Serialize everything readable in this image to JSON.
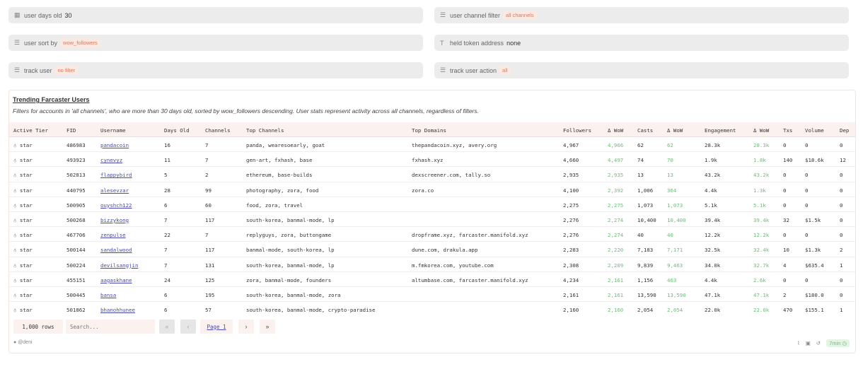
{
  "filters": [
    {
      "icon": "calendar-icon",
      "glyph": "▦",
      "label": "user days old",
      "value": "30",
      "type": "value"
    },
    {
      "icon": "list-icon",
      "glyph": "☰",
      "label": "user channel filter",
      "value": "all channels",
      "type": "tag"
    },
    {
      "icon": "list-icon",
      "glyph": "☰",
      "label": "user sort by",
      "value": "wow_followers",
      "type": "tag"
    },
    {
      "icon": "text-icon",
      "glyph": "T",
      "label": "held token address",
      "value": "none",
      "type": "value"
    },
    {
      "icon": "list-icon",
      "glyph": "☰",
      "label": "track user",
      "value": "no filter",
      "type": "tag"
    },
    {
      "icon": "list-icon",
      "glyph": "☰",
      "label": "track user action",
      "value": "all",
      "type": "tag"
    }
  ],
  "card": {
    "title": "Trending Farcaster Users",
    "description": "Filters for accounts in 'all channels', who are more than 30 days old, sorted by wow_followers descending. User stats represent activity across all channels, regardless of filters."
  },
  "table": {
    "columns": [
      "Active Tier",
      "FID",
      "Username",
      "Days Old",
      "Channels",
      "Top Channels",
      "Top Domains",
      "Followers",
      "Δ WoW",
      "Casts",
      "Δ WoW",
      "Engagement",
      "Δ WoW",
      "Txs",
      "Volume",
      "Dep"
    ],
    "rows": [
      [
        "star",
        "486983",
        "pandacoin",
        "16",
        "7",
        "panda, wearesoearly, goat",
        "thepandacoin.xyz, avery.org",
        "4,967",
        "4,966",
        "62",
        "62",
        "28.3k",
        "28.3k",
        "0",
        "0",
        "0"
      ],
      [
        "star",
        "493923",
        "cynevyz",
        "11",
        "7",
        "gen-art, fxhash, base",
        "fxhash.xyz",
        "4,660",
        "4,497",
        "74",
        "70",
        "1.9k",
        "1.8k",
        "140",
        "$18.6k",
        "12"
      ],
      [
        "star",
        "502813",
        "flappybird",
        "5",
        "2",
        "ethereum, base-builds",
        "dexscreener.com, tally.so",
        "2,935",
        "2,935",
        "13",
        "13",
        "43.2k",
        "43.2k",
        "0",
        "0",
        "0"
      ],
      [
        "star",
        "440795",
        "alesevzar",
        "28",
        "99",
        "photography, zora, food",
        "zora.co",
        "4,100",
        "2,392",
        "1,006",
        "364",
        "4.4k",
        "1.3k",
        "0",
        "0",
        "0"
      ],
      [
        "star",
        "500905",
        "ouyshch122",
        "6",
        "60",
        "food, zora, travel",
        "",
        "2,275",
        "2,275",
        "1,073",
        "1,073",
        "5.1k",
        "5.1k",
        "0",
        "0",
        "0"
      ],
      [
        "star",
        "500268",
        "bizzykong",
        "7",
        "117",
        "south-korea, banmal-mode, lp",
        "",
        "2,276",
        "2,274",
        "10,400",
        "10,400",
        "39.4k",
        "39.4k",
        "32",
        "$1.5k",
        "0"
      ],
      [
        "star",
        "467706",
        "zenpulse",
        "22",
        "7",
        "replyguys, zora, buttongame",
        "dropframe.xyz, farcaster.manifold.xyz",
        "2,276",
        "2,274",
        "40",
        "40",
        "12.2k",
        "12.2k",
        "0",
        "0",
        "0"
      ],
      [
        "star",
        "500144",
        "sandalwood",
        "7",
        "117",
        "banmal-mode, south-korea, lp",
        "dune.com, drakula.app",
        "2,283",
        "2,220",
        "7,183",
        "7,171",
        "32.5k",
        "32.4k",
        "10",
        "$1.3k",
        "2"
      ],
      [
        "star",
        "500224",
        "devilsangjin",
        "7",
        "131",
        "south-korea, banmal-mode, lp",
        "m.fmkorea.com, youtube.com",
        "2,308",
        "2,209",
        "9,839",
        "9,463",
        "34.0k",
        "32.7k",
        "4",
        "$635.4",
        "1"
      ],
      [
        "star",
        "455151",
        "aagaskhane",
        "24",
        "125",
        "zora, banmal-mode, founders",
        "altumbase.com, farcaster.manifold.xyz",
        "4,234",
        "2,161",
        "1,156",
        "463",
        "4.4k",
        "2.6k",
        "0",
        "0",
        "0"
      ],
      [
        "star",
        "500445",
        "bansa",
        "6",
        "195",
        "south-korea, banmal-mode, zora",
        "",
        "2,161",
        "2,161",
        "13,590",
        "13,590",
        "47.1k",
        "47.1k",
        "2",
        "$180.0",
        "0"
      ],
      [
        "star",
        "501862",
        "bhanohhunee",
        "6",
        "57",
        "south-korea, banmal-mode, crypto-paradise",
        "",
        "2,160",
        "2,160",
        "2,054",
        "2,054",
        "22.0k",
        "22.0k",
        "470",
        "$155.1",
        "1"
      ]
    ]
  },
  "pagination": {
    "rows": "1,000 rows",
    "search_placeholder": "Search...",
    "first": "«",
    "prev": "‹",
    "page": "Page 1",
    "next": "›",
    "last": "»"
  },
  "footer": {
    "author": "@deni",
    "freshness": "7min"
  }
}
